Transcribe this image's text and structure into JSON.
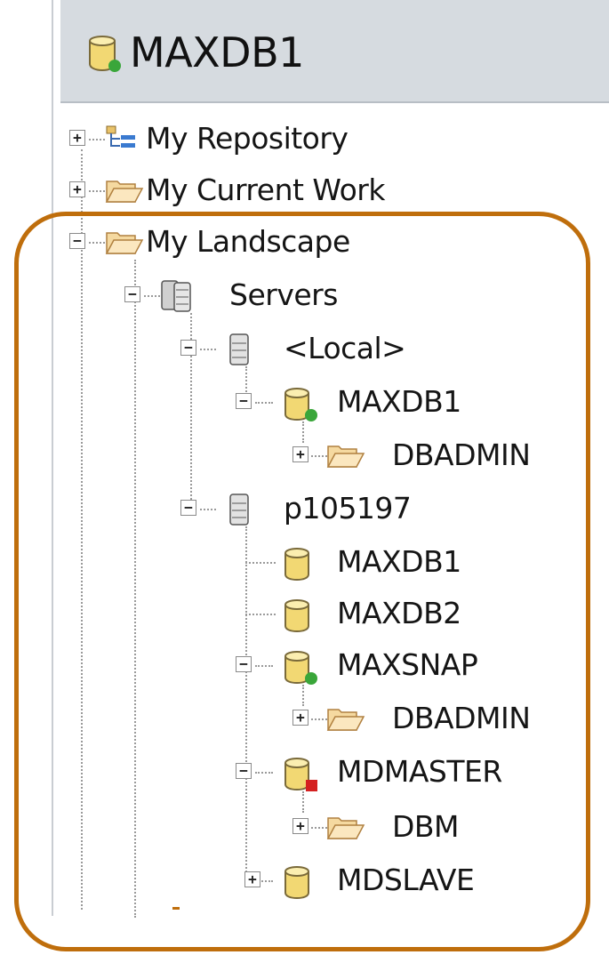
{
  "title": {
    "text": "MAXDB1",
    "icon": "database-connected-icon"
  },
  "tree": [
    {
      "label": "My Repository",
      "icon": "repository-icon",
      "expander": "+"
    },
    {
      "label": "My Current Work",
      "icon": "folder-icon",
      "expander": "+"
    },
    {
      "label": "My Landscape",
      "icon": "folder-open-icon",
      "expander": "−"
    },
    {
      "label": "Servers",
      "icon": "servers-icon",
      "expander": "−"
    },
    {
      "label": "<Local>",
      "icon": "server-icon",
      "expander": "−"
    },
    {
      "label": "MAXDB1",
      "icon": "database-online-icon",
      "expander": "−",
      "status": "online"
    },
    {
      "label": "DBADMIN",
      "icon": "folder-icon",
      "expander": "+"
    },
    {
      "label": "p105197",
      "icon": "server-icon",
      "expander": "−"
    },
    {
      "label": "MAXDB1",
      "icon": "database-icon"
    },
    {
      "label": "MAXDB2",
      "icon": "database-icon"
    },
    {
      "label": "MAXSNAP",
      "icon": "database-online-icon",
      "expander": "−",
      "status": "online"
    },
    {
      "label": "DBADMIN",
      "icon": "folder-icon",
      "expander": "+"
    },
    {
      "label": "MDMASTER",
      "icon": "database-offline-icon",
      "expander": "−",
      "status": "offline"
    },
    {
      "label": "DBM",
      "icon": "folder-icon",
      "expander": "+"
    },
    {
      "label": "MDSLAVE",
      "icon": "database-icon",
      "expander": "+"
    }
  ],
  "colors": {
    "highlight": "#bf6e0c",
    "online": "#3aa63a",
    "offline": "#d42020",
    "db_fill": "#f2d873"
  }
}
